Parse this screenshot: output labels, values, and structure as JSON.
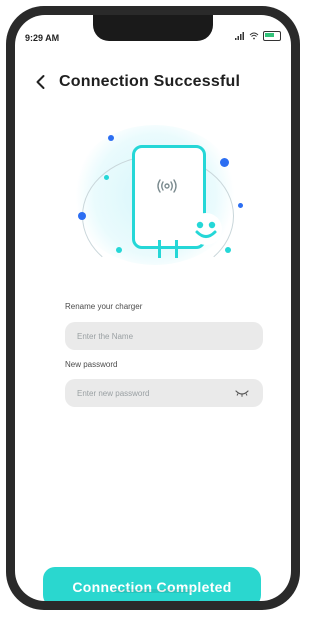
{
  "status_bar": {
    "time": "9:29 AM"
  },
  "header": {
    "title": "Connection Successful"
  },
  "form": {
    "rename_label": "Rename your charger",
    "rename_placeholder": "Enter the Name",
    "password_label": "New password",
    "password_placeholder": "Enter new password"
  },
  "footer": {
    "button_label": "Connection Completed"
  },
  "colors": {
    "accent": "#2ad7cf",
    "charger_outline": "#25d7d7",
    "dot_blue": "#2c6ef2",
    "dot_teal": "#25d7d7",
    "field_bg": "#eaeaea"
  },
  "icons": {
    "back": "chevron-left-icon",
    "wifi": "wifi-signal-icon",
    "smile": "smile-face-icon",
    "eye": "eye-toggle-icon"
  }
}
